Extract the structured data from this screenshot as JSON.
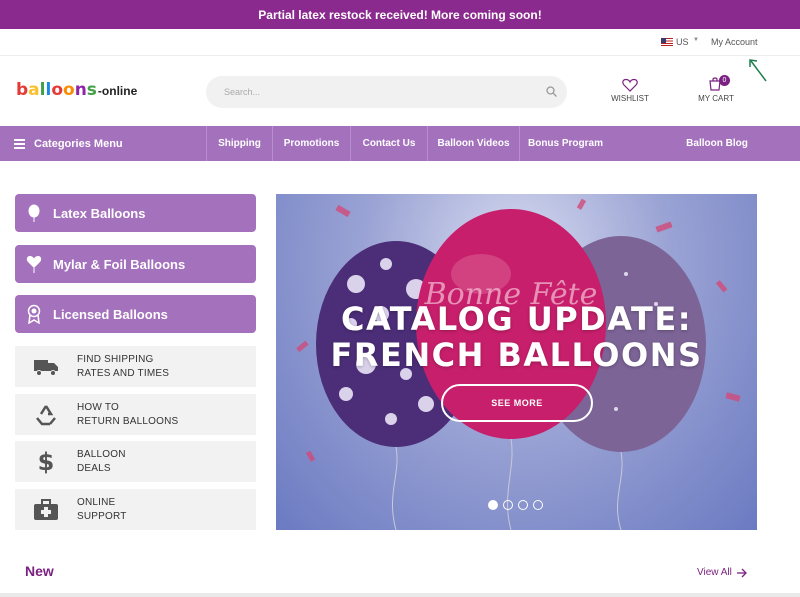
{
  "banner": {
    "text": "Partial latex restock received! More coming soon!"
  },
  "topbar": {
    "country": "US",
    "account": "My Account"
  },
  "logo": {
    "letters": [
      "b",
      "a",
      "l",
      "l",
      "o",
      "o",
      "n",
      "s"
    ],
    "suffix": "-online"
  },
  "search": {
    "placeholder": "Search..."
  },
  "header": {
    "wishlist_label": "WISHLIST",
    "cart_label": "MY CART",
    "cart_count": "0"
  },
  "nav": {
    "categories_label": "Categories Menu",
    "items": [
      "Shipping",
      "Promotions",
      "Contact Us",
      "Balloon Videos",
      "Bonus Program",
      "Balloon Blog"
    ]
  },
  "sidebar": {
    "categories": [
      "Latex Balloons",
      "Mylar & Foil Balloons",
      "Licensed Balloons"
    ],
    "info": [
      {
        "line1": "FIND SHIPPING",
        "line2": "RATES AND TIMES",
        "icon": "truck-icon"
      },
      {
        "line1": "HOW TO",
        "line2": "RETURN BALLOONS",
        "icon": "recycle-icon"
      },
      {
        "line1": "BALLOON",
        "line2": "DEALS",
        "icon": "dollar-icon"
      },
      {
        "line1": "ONLINE",
        "line2": "SUPPORT",
        "icon": "first-aid-kit-icon"
      }
    ]
  },
  "slider": {
    "title_line1": "CATALOG UPDATE:",
    "title_line2": "FRENCH BALLOONS",
    "button": "SEE MORE",
    "balloon_text": "Bonne Fête",
    "active_slide": 1,
    "slide_count": 4
  },
  "new_section": {
    "title": "New",
    "view_all": "View All"
  },
  "colors": {
    "brand": "#8b2a8e",
    "nav": "#a471bd",
    "accent": "#7b2181"
  }
}
